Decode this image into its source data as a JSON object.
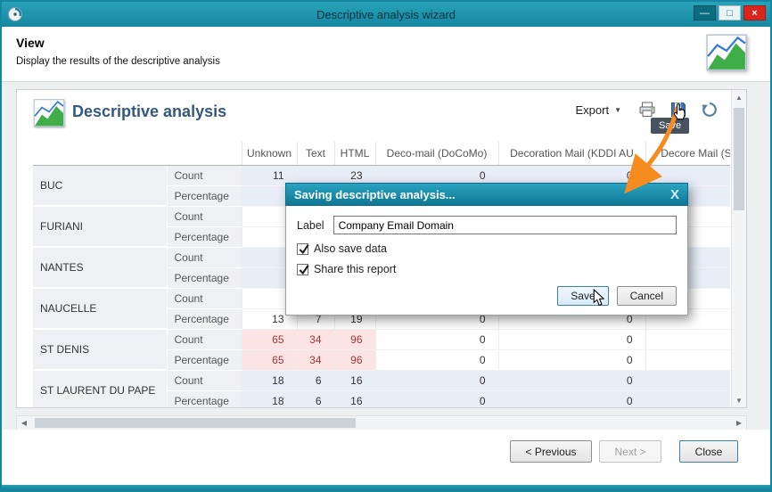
{
  "titlebar": {
    "title": "Descriptive analysis wizard"
  },
  "view_header": {
    "title": "View",
    "subtitle": "Display the results of the descriptive analysis"
  },
  "panel": {
    "title": "Descriptive analysis",
    "toolbar": {
      "export_label": "Export",
      "save_tooltip": "Save"
    }
  },
  "table": {
    "columns": [
      "Unknown",
      "Text",
      "HTML",
      "Deco-mail (DoCoMo)",
      "Decoration Mail (KDDI AU",
      "Decore Mail (So"
    ],
    "stat_labels": [
      "Count",
      "Percentage"
    ],
    "rows": [
      {
        "city": "BUC",
        "tint": true,
        "highlight_cols": 0,
        "count": [
          "11",
          "",
          "23",
          "0",
          "0",
          ""
        ],
        "percentage": [
          "",
          "",
          "",
          "",
          "",
          ""
        ]
      },
      {
        "city": "FURIANI",
        "tint": false,
        "highlight_cols": 0,
        "count": [
          "",
          "",
          "",
          "",
          "",
          ""
        ],
        "percentage": [
          "",
          "",
          "",
          "",
          "",
          ""
        ]
      },
      {
        "city": "NANTES",
        "tint": true,
        "highlight_cols": 0,
        "count": [
          "",
          "",
          "",
          "",
          "",
          ""
        ],
        "percentage": [
          "",
          "",
          "",
          "",
          "",
          ""
        ]
      },
      {
        "city": "NAUCELLE",
        "tint": false,
        "highlight_cols": 0,
        "count": [
          "",
          "",
          "",
          "",
          "",
          ""
        ],
        "percentage": [
          "13",
          "7",
          "19",
          "0",
          "0",
          ""
        ]
      },
      {
        "city": "ST DENIS",
        "tint": false,
        "highlight_cols": 3,
        "count": [
          "65",
          "34",
          "96",
          "0",
          "0",
          ""
        ],
        "percentage": [
          "65",
          "34",
          "96",
          "0",
          "0",
          ""
        ]
      },
      {
        "city": "ST LAURENT DU PAPE",
        "tint": true,
        "highlight_cols": 0,
        "count": [
          "18",
          "6",
          "16",
          "0",
          "0",
          ""
        ],
        "percentage": [
          "18",
          "6",
          "16",
          "0",
          "0",
          ""
        ]
      }
    ]
  },
  "dialog": {
    "title": "Saving descriptive analysis...",
    "close_glyph": "X",
    "label_caption": "Label",
    "label_value": "Company Email Domain",
    "checkboxes": [
      {
        "label": "Also save data",
        "checked": true
      },
      {
        "label": "Share this report",
        "checked": true
      }
    ],
    "save_label": "Save",
    "cancel_label": "Cancel"
  },
  "footer": {
    "previous_label": "< Previous",
    "next_label": "Next >",
    "close_label": "Close"
  },
  "icons": {
    "export_caret": "▼",
    "scroll_up": "▲",
    "scroll_down": "▼",
    "scroll_left": "◀",
    "scroll_right": "▶",
    "min_glyph": "—",
    "max_glyph": "□",
    "close_glyph": "×"
  },
  "colors": {
    "accent_teal": "#1687a0",
    "arrow_orange": "#f68b1f",
    "highlight_pink": "#fbe4e3",
    "tint_blue": "#e9edf8"
  }
}
